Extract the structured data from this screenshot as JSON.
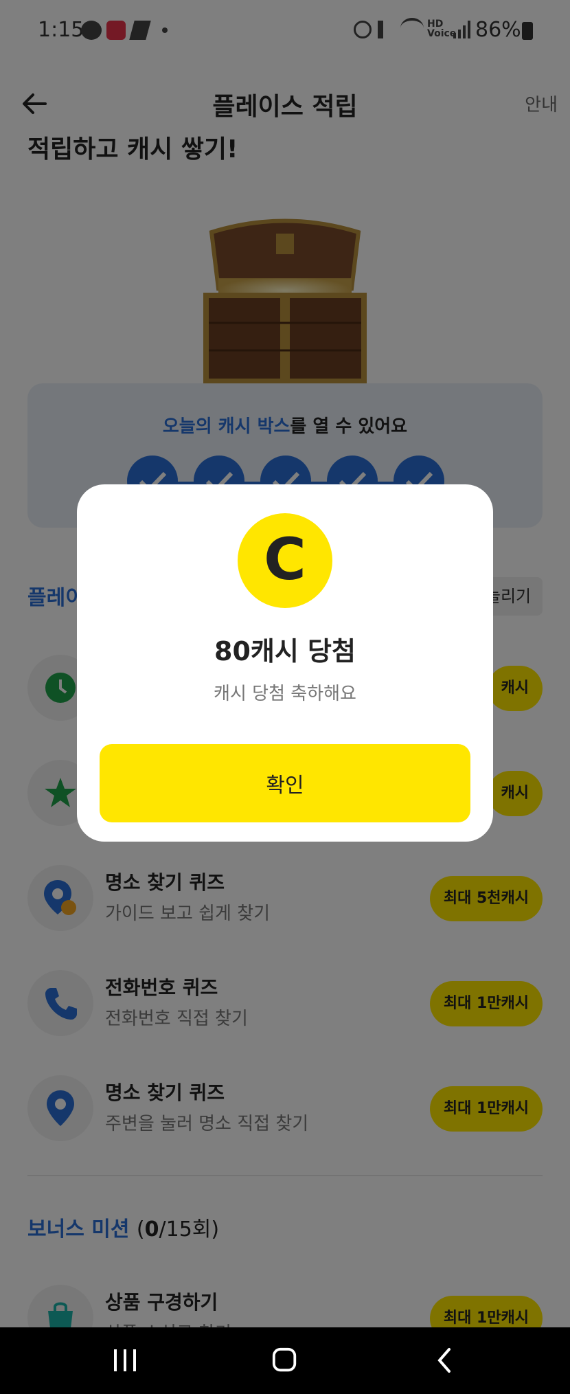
{
  "status_bar": {
    "time": "1:15",
    "battery": "86%"
  },
  "header": {
    "title": "플레이스 적립",
    "guide": "안내"
  },
  "partial_heading": "적립하고 캐시 쌓기!",
  "cash_box": {
    "text_highlight": "오늘의 캐시 박스",
    "text_rest": "를 열 수 있어요",
    "checks_done": 5
  },
  "section1": {
    "title_partial": "플레이",
    "more_label": "늘리기"
  },
  "missions": [
    {
      "title": "",
      "subtitle": "",
      "badge": "캐시",
      "icon": "clock-icon"
    },
    {
      "title": "",
      "subtitle": "",
      "badge": "캐시",
      "icon": "star-icon"
    },
    {
      "title": "명소 찾기 퀴즈",
      "subtitle": "가이드 보고 쉽게 찾기",
      "badge": "최대 5천캐시",
      "icon": "location-smile-icon"
    },
    {
      "title": "전화번호 퀴즈",
      "subtitle": "전화번호 직접 찾기",
      "badge": "최대 1만캐시",
      "icon": "phone-icon"
    },
    {
      "title": "명소 찾기 퀴즈",
      "subtitle": "주변을 눌러 명소 직접 찾기",
      "badge": "최대 1만캐시",
      "icon": "location-pin-icon"
    }
  ],
  "bonus": {
    "title": "보너스 미션",
    "count_open": "(",
    "count_done": "0",
    "count_rest": "/15회)",
    "first_item": {
      "title": "상품 구경하기",
      "subtitle": "상품 소식로 찾기",
      "badge": "최대 1만캐시"
    }
  },
  "modal": {
    "coin_letter": "C",
    "title": "80캐시 당첨",
    "subtitle": "캐시 당첨 축하해요",
    "confirm_label": "확인"
  },
  "colors": {
    "accent_yellow": "#ffe600",
    "accent_blue": "#2a6fd6"
  }
}
